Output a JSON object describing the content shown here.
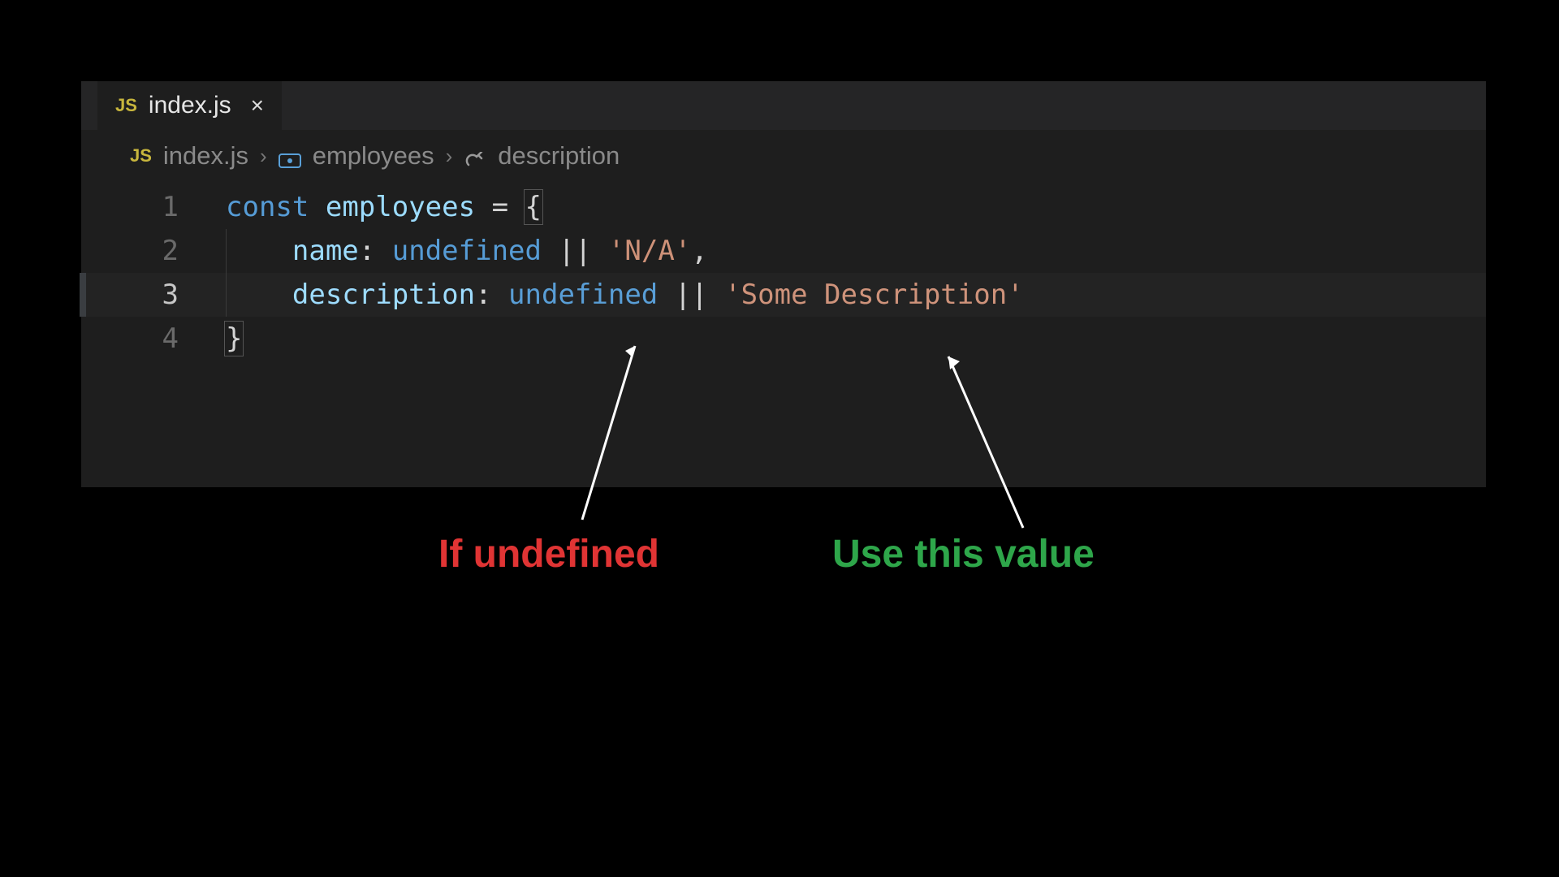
{
  "tab": {
    "js_badge": "JS",
    "filename": "index.js",
    "close_label": "×"
  },
  "breadcrumbs": {
    "js_badge": "JS",
    "file": "index.js",
    "symbol": "employees",
    "member": "description"
  },
  "code": {
    "line_numbers": [
      "1",
      "2",
      "3",
      "4"
    ],
    "active_line": 3,
    "l1": {
      "kw": "const",
      "var": "employees",
      "eq": "=",
      "brace": "{"
    },
    "l2": {
      "prop": "name",
      "colon": ":",
      "undef": "undefined",
      "or": "||",
      "str": "'N/A'",
      "comma": ","
    },
    "l3": {
      "prop": "description",
      "colon": ":",
      "undef": "undefined",
      "or": "||",
      "str": "'Some Description'"
    },
    "l4": {
      "brace": "}"
    }
  },
  "annotations": {
    "left": "If undefined",
    "right": "Use this value"
  }
}
